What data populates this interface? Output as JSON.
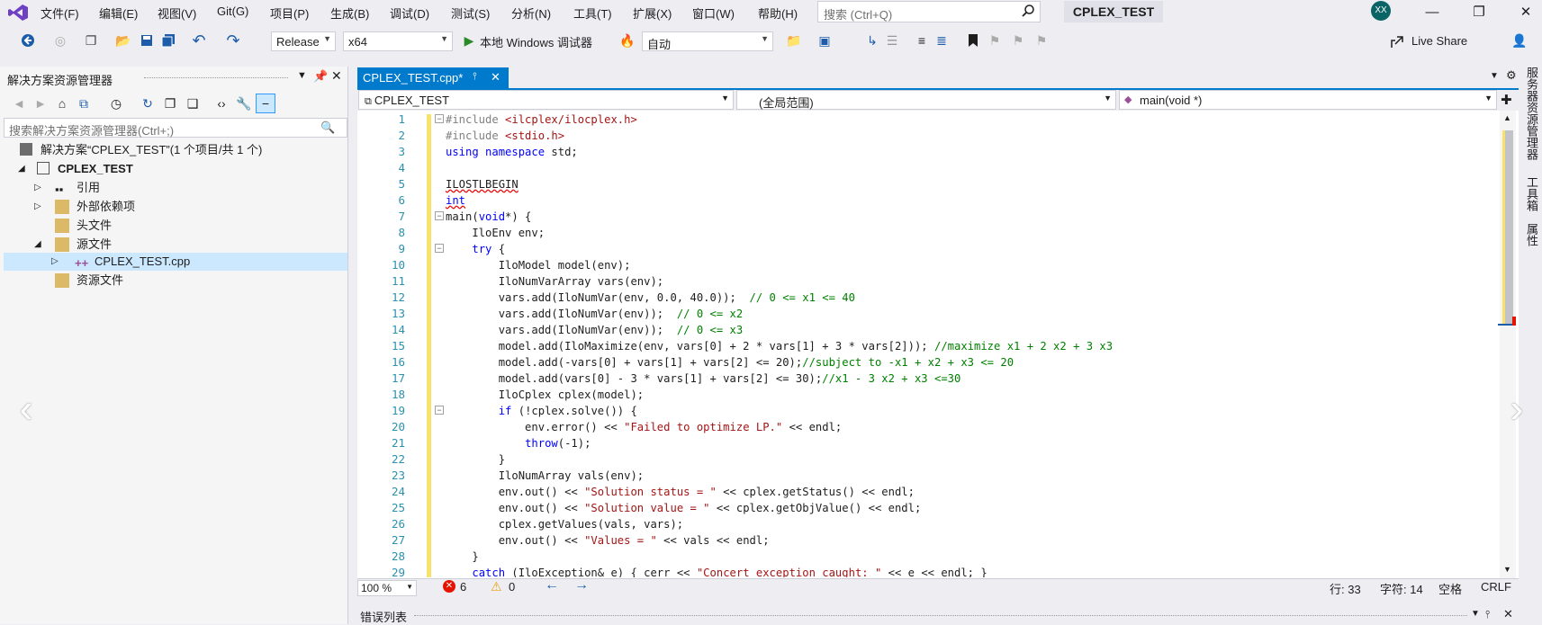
{
  "menu": {
    "items": [
      "文件(F)",
      "编辑(E)",
      "视图(V)",
      "Git(G)",
      "项目(P)",
      "生成(B)",
      "调试(D)",
      "测试(S)",
      "分析(N)",
      "工具(T)",
      "扩展(X)",
      "窗口(W)",
      "帮助(H)"
    ],
    "search_placeholder": "搜索 (Ctrl+Q)",
    "solution_name": "CPLEX_TEST",
    "avatar_initials": "XX"
  },
  "toolbar": {
    "configuration": "Release",
    "platform": "x64",
    "debugger": "本地 Windows 调试器",
    "solution_config": "自动",
    "live_share": "Live Share"
  },
  "solution_explorer": {
    "title": "解决方案资源管理器",
    "search_placeholder": "搜索解决方案资源管理器(Ctrl+;)",
    "tree": [
      {
        "label": "解决方案“CPLEX_TEST”(1 个项目/共 1 个)",
        "level": 0,
        "bold": false
      },
      {
        "label": "CPLEX_TEST",
        "level": 1,
        "bold": true
      },
      {
        "label": "引用",
        "level": 2,
        "bold": false
      },
      {
        "label": "外部依赖项",
        "level": 2,
        "bold": false
      },
      {
        "label": "头文件",
        "level": 2,
        "bold": false
      },
      {
        "label": "源文件",
        "level": 2,
        "bold": false
      },
      {
        "label": "CPLEX_TEST.cpp",
        "level": 3,
        "bold": false
      },
      {
        "label": "资源文件",
        "level": 2,
        "bold": false
      }
    ]
  },
  "editor": {
    "tab_label": "CPLEX_TEST.cpp*",
    "nav_project": "CPLEX_TEST",
    "nav_scope": "(全局范围)",
    "nav_member": "main(void *)",
    "line_numbers": [
      "1",
      "2",
      "3",
      "4",
      "5",
      "6",
      "7",
      "8",
      "9",
      "10",
      "11",
      "12",
      "13",
      "14",
      "15",
      "16",
      "17",
      "18",
      "19",
      "20",
      "21",
      "22",
      "23",
      "24",
      "25",
      "26",
      "27",
      "28",
      "29"
    ]
  },
  "status": {
    "zoom": "100 %",
    "errors": "6",
    "warnings": "0",
    "line": "行: 33",
    "col": "字符: 14",
    "whitespace": "空格",
    "eol": "CRLF"
  },
  "error_list": {
    "title": "错误列表"
  },
  "right_tabs": [
    "服务器资源管理器",
    "工具箱",
    "属性"
  ]
}
